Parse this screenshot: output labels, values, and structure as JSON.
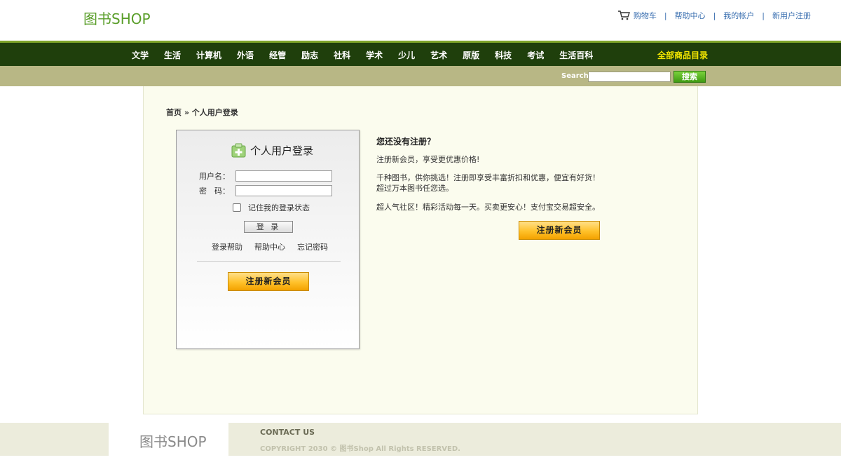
{
  "header": {
    "logo": "图书SHOP",
    "links": [
      "购物车",
      "帮助中心",
      "我的帐户",
      "新用户注册"
    ],
    "separator": "|"
  },
  "nav": {
    "items": [
      "文学",
      "生活",
      "计算机",
      "外语",
      "经管",
      "励志",
      "社科",
      "学术",
      "少儿",
      "艺术",
      "原版",
      "科技",
      "考试",
      "生活百科"
    ],
    "all_label": "全部商品目录"
  },
  "search": {
    "label": "Search",
    "value": "",
    "button": "搜索"
  },
  "breadcrumb": "首页 » 个人用户登录",
  "login": {
    "title": "个人用户登录",
    "username_label": "用户名：",
    "password_label": "密　码：",
    "username_value": "",
    "password_value": "",
    "remember_label": "记住我的登录状态",
    "submit": "登 录",
    "help_links": [
      "登录帮助",
      "帮助中心",
      "忘记密码"
    ],
    "register_button": "注册新会员"
  },
  "side": {
    "title": "您还没有注册？",
    "p1": "注册新会员，享受更优惠价格!",
    "p2": "千种图书，供你挑选！注册即享受丰富折扣和优惠，便宜有好货！超过万本图书任您选。",
    "p3": "超人气社区！精彩活动每一天。买卖更安心！支付宝交易超安全。",
    "register_button": "注册新会员"
  },
  "footer": {
    "logo": "图书SHOP",
    "contact": "CONTACT US",
    "copyright": "COPYRIGHT 2030 © 图书Shop All Rights RESERVED."
  }
}
